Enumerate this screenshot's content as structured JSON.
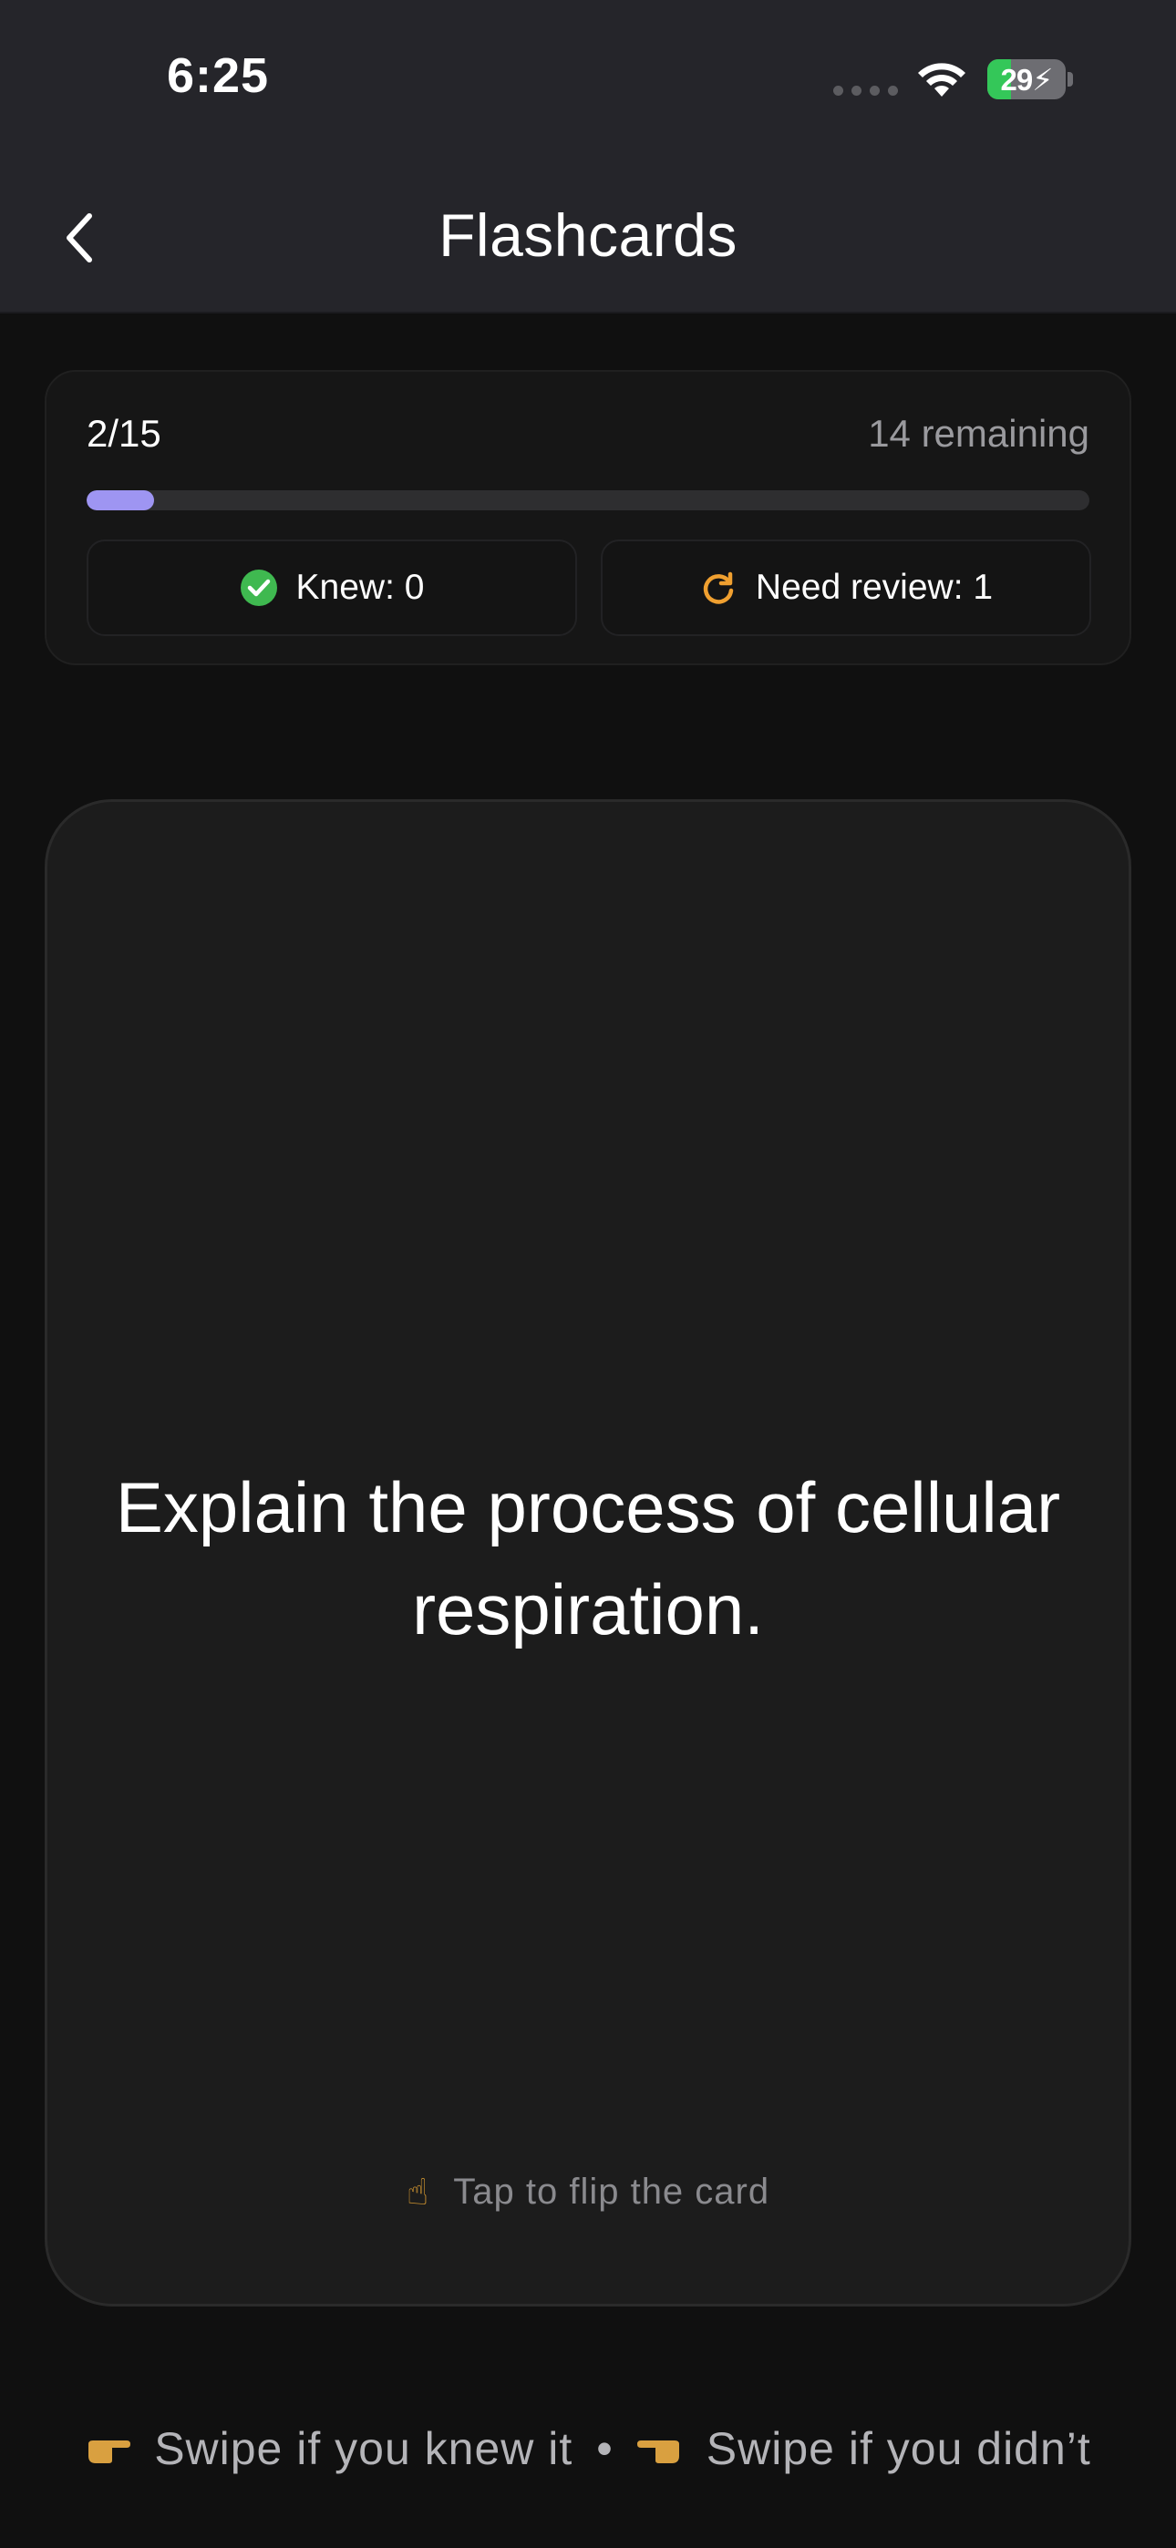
{
  "status_bar": {
    "time": "6:25",
    "battery_percent": "29",
    "battery_level": 0.29,
    "icons": [
      "cellular-signal-icon",
      "wifi-icon",
      "battery-charging-icon"
    ]
  },
  "nav": {
    "title": "Flashcards",
    "back_icon": "chevron-left-icon"
  },
  "progress": {
    "count": "2/15",
    "remaining": "14 remaining",
    "fraction": 0.067,
    "knew_label": "Knew: 0",
    "review_label": "Need review: 1",
    "knew_icon": "check-circle-icon",
    "review_icon": "refresh-icon"
  },
  "card": {
    "question": "Explain the process of cellular respiration.",
    "flip_hint": "Tap to flip the card",
    "flip_icon": "pointing-up-hand-icon"
  },
  "swipe_hint": {
    "right_text": "Swipe if you knew it",
    "separator": "•",
    "left_text": "Swipe if you didn’t",
    "right_icon": "pointing-right-hand-icon",
    "left_icon": "pointing-left-hand-icon"
  },
  "colors": {
    "accent": "#9e95f2",
    "success": "#3fb950",
    "warning": "#f0a030",
    "background": "#101010",
    "card": "#1c1c1c",
    "topbar": "#25252a"
  }
}
